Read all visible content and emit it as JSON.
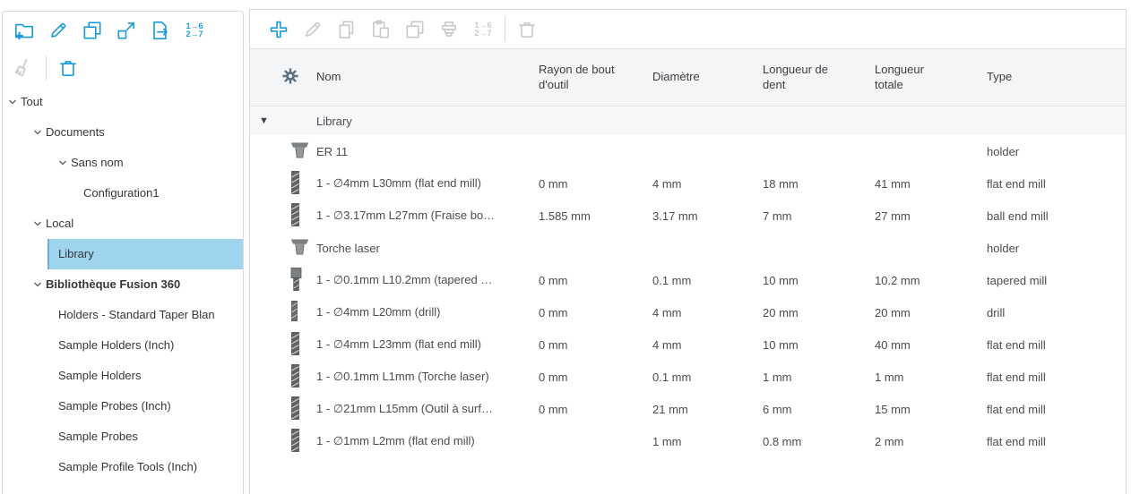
{
  "colors": {
    "accent": "#1a9bd7",
    "disabled_icon": "#c7c9cb",
    "selection_bg": "#9fd4ef",
    "header_bg": "#f4f5f7",
    "group_row_bg": "#f7f8fa",
    "gear": "#5e7181"
  },
  "sidebar": {
    "toolbar_row1": [
      {
        "name": "new-library-button",
        "icon": "folder-plus",
        "enabled": true
      },
      {
        "name": "edit-library-button",
        "icon": "pencil",
        "enabled": true
      },
      {
        "name": "copy-library-button",
        "icon": "copy-squares",
        "enabled": true
      },
      {
        "name": "import-library-button",
        "icon": "square-arrow",
        "enabled": true
      },
      {
        "name": "export-library-button",
        "icon": "doc-export",
        "enabled": true
      },
      {
        "name": "renumber-button",
        "icon": "renumber",
        "enabled": true,
        "text": "1→6\n2→7"
      }
    ],
    "toolbar_row2": [
      {
        "name": "clean-library-button",
        "icon": "broom",
        "enabled": false
      },
      {
        "divider": true
      },
      {
        "name": "delete-library-button",
        "icon": "trash",
        "enabled": true
      }
    ],
    "tree": [
      {
        "label": "Tout",
        "level": 0,
        "chevron": true,
        "selected": false,
        "bold": false
      },
      {
        "label": "Documents",
        "level": 1,
        "chevron": true,
        "selected": false,
        "bold": false
      },
      {
        "label": "Sans nom",
        "level": 2,
        "chevron": true,
        "selected": false,
        "bold": false
      },
      {
        "label": "Configuration1",
        "level": 3,
        "chevron": false,
        "selected": false,
        "bold": false
      },
      {
        "label": "Local",
        "level": 1,
        "chevron": true,
        "selected": false,
        "bold": false
      },
      {
        "label": "Library",
        "level": 2,
        "chevron": false,
        "selected": true,
        "bold": false
      },
      {
        "label": "Bibliothèque Fusion 360",
        "level": 1,
        "chevron": true,
        "selected": false,
        "bold": true
      },
      {
        "label": "Holders - Standard Taper Blan",
        "level": 2,
        "chevron": false,
        "selected": false,
        "bold": false
      },
      {
        "label": "Sample Holders (Inch)",
        "level": 2,
        "chevron": false,
        "selected": false,
        "bold": false
      },
      {
        "label": "Sample Holders",
        "level": 2,
        "chevron": false,
        "selected": false,
        "bold": false
      },
      {
        "label": "Sample Probes (Inch)",
        "level": 2,
        "chevron": false,
        "selected": false,
        "bold": false
      },
      {
        "label": "Sample Probes",
        "level": 2,
        "chevron": false,
        "selected": false,
        "bold": false
      },
      {
        "label": "Sample Profile Tools (Inch)",
        "level": 2,
        "chevron": false,
        "selected": false,
        "bold": false
      }
    ]
  },
  "main": {
    "toolbar": [
      {
        "name": "add-tool-button",
        "icon": "plus-bold",
        "enabled": true
      },
      {
        "name": "edit-tool-button",
        "icon": "pencil",
        "enabled": false
      },
      {
        "name": "copy-tool-button",
        "icon": "copy-docs",
        "enabled": false
      },
      {
        "name": "paste-tool-button",
        "icon": "clipboard",
        "enabled": false
      },
      {
        "name": "duplicate-tool-button",
        "icon": "copy-squares",
        "enabled": false
      },
      {
        "name": "create-holder-button",
        "icon": "holder-stack",
        "enabled": false
      },
      {
        "name": "renumber-tools-button",
        "icon": "renumber",
        "enabled": false,
        "text": "1→6\n2→7"
      },
      {
        "divider": true
      },
      {
        "name": "delete-tool-button",
        "icon": "trash",
        "enabled": false
      }
    ],
    "table": {
      "columns": [
        "Nom",
        "Rayon de bout\nd'outil",
        "Diamètre",
        "Longueur de\ndent",
        "Longueur\ntotale",
        "Type"
      ],
      "group": {
        "label": "Library",
        "expanded": true
      },
      "rows": [
        {
          "icon": "holder",
          "name": "ER 11",
          "radius": "",
          "diameter": "",
          "flute_length": "",
          "overall_length": "",
          "type": "holder"
        },
        {
          "icon": "endmill",
          "name": "1 - ∅4mm L30mm (flat end mill)",
          "radius": "0 mm",
          "diameter": "4 mm",
          "flute_length": "18 mm",
          "overall_length": "41 mm",
          "type": "flat end mill"
        },
        {
          "icon": "endmill",
          "name": "1 - ∅3.17mm L27mm (Fraise bo…",
          "radius": "1.585 mm",
          "diameter": "3.17 mm",
          "flute_length": "7 mm",
          "overall_length": "27 mm",
          "type": "ball end mill"
        },
        {
          "icon": "holder",
          "name": "Torche laser",
          "radius": "",
          "diameter": "",
          "flute_length": "",
          "overall_length": "",
          "type": "holder"
        },
        {
          "icon": "tapered",
          "name": "1 - ∅0.1mm L10.2mm (tapered …",
          "radius": "0 mm",
          "diameter": "0.1 mm",
          "flute_length": "10 mm",
          "overall_length": "10.2 mm",
          "type": "tapered mill"
        },
        {
          "icon": "drill",
          "name": "1 - ∅4mm L20mm (drill)",
          "radius": "0 mm",
          "diameter": "4 mm",
          "flute_length": "20 mm",
          "overall_length": "20 mm",
          "type": "drill"
        },
        {
          "icon": "endmill",
          "name": "1 - ∅4mm L23mm (flat end mill)",
          "radius": "0 mm",
          "diameter": "4 mm",
          "flute_length": "10 mm",
          "overall_length": "40 mm",
          "type": "flat end mill"
        },
        {
          "icon": "endmill",
          "name": "1 - ∅0.1mm L1mm (Torche laser)",
          "radius": "0 mm",
          "diameter": "0.1 mm",
          "flute_length": "1 mm",
          "overall_length": "1 mm",
          "type": "flat end mill"
        },
        {
          "icon": "endmill",
          "name": "1 - ∅21mm L15mm (Outil à surf…",
          "radius": "0 mm",
          "diameter": "21 mm",
          "flute_length": "6 mm",
          "overall_length": "15 mm",
          "type": "flat end mill"
        },
        {
          "icon": "endmill",
          "name": "1 - ∅1mm L2mm (flat end mill)",
          "radius": "",
          "diameter": "1 mm",
          "flute_length": "0.8 mm",
          "overall_length": "2 mm",
          "type": "flat end mill"
        }
      ]
    }
  }
}
